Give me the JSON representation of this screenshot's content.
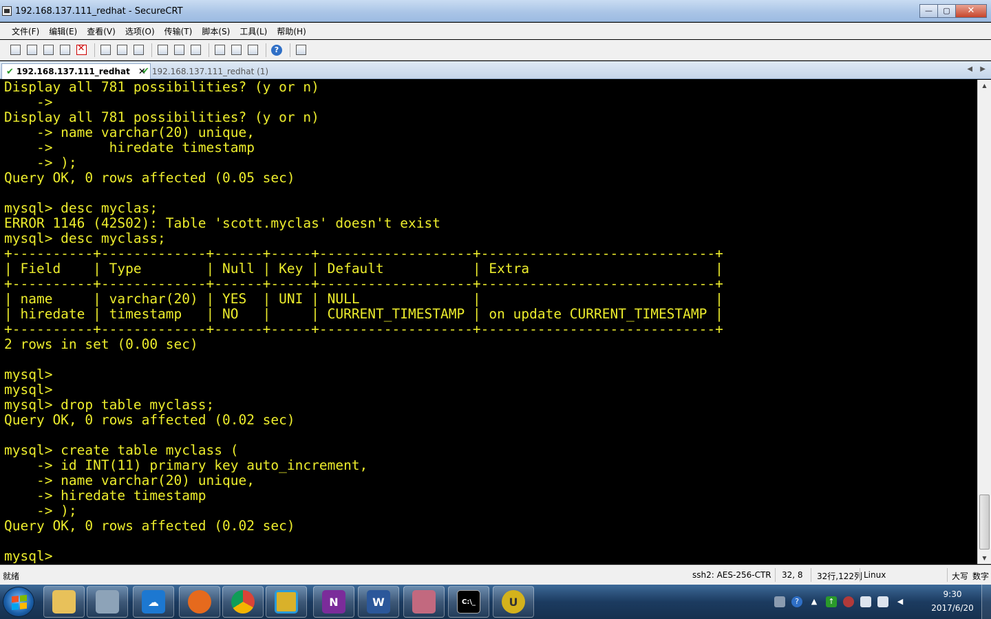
{
  "window": {
    "title": "192.168.137.111_redhat - SecureCRT",
    "minimize": "—",
    "maximize": "▢",
    "close": "✕"
  },
  "menu": [
    "文件(F)",
    "编辑(E)",
    "查看(V)",
    "选项(O)",
    "传输(T)",
    "脚本(S)",
    "工具(L)",
    "帮助(H)"
  ],
  "toolbar_icons": [
    "connect-icon",
    "quick-connect-icon",
    "connect-tab-icon",
    "reconnect-icon",
    "disconnect-icon",
    "copy-icon",
    "paste-icon",
    "find-icon",
    "print-icon",
    "print-selection-icon",
    "print-setup-icon",
    "session-options-icon",
    "global-options-icon",
    "keymap-icon",
    "help-icon",
    "sftp-icon"
  ],
  "tabs": [
    {
      "label": "192.168.137.111_redhat",
      "active": true,
      "close": "✕",
      "status": "✔"
    },
    {
      "label": "192.168.137.111_redhat (1)",
      "active": false,
      "status": "✔"
    }
  ],
  "tab_nav": {
    "left": "◀",
    "right": "▶"
  },
  "terminal": {
    "text_color": "#ECEC2C",
    "lines": [
      "Display all 781 possibilities? (y or n)",
      "    ->",
      "Display all 781 possibilities? (y or n)",
      "    -> name varchar(20) unique,",
      "    ->       hiredate timestamp",
      "    -> );",
      "Query OK, 0 rows affected (0.05 sec)",
      "",
      "mysql> desc myclas;",
      "ERROR 1146 (42S02): Table 'scott.myclas' doesn't exist",
      "mysql> desc myclass;",
      "+----------+-------------+------+-----+-------------------+-----------------------------+",
      "| Field    | Type        | Null | Key | Default           | Extra                       |",
      "+----------+-------------+------+-----+-------------------+-----------------------------+",
      "| name     | varchar(20) | YES  | UNI | NULL              |                             |",
      "| hiredate | timestamp   | NO   |     | CURRENT_TIMESTAMP | on update CURRENT_TIMESTAMP |",
      "+----------+-------------+------+-----+-------------------+-----------------------------+",
      "2 rows in set (0.00 sec)",
      "",
      "mysql>",
      "mysql>",
      "mysql> drop table myclass;",
      "Query OK, 0 rows affected (0.02 sec)",
      "",
      "mysql> create table myclass (",
      "    -> id INT(11) primary key auto_increment,",
      "    -> name varchar(20) unique,",
      "    -> hiredate timestamp",
      "    -> );",
      "Query OK, 0 rows affected (0.02 sec)",
      "",
      "mysql>"
    ]
  },
  "statusbar": {
    "ready": "就绪",
    "protocol": "ssh2: AES-256-CTR",
    "cursor": "32,  8",
    "size": "32行,122列",
    "emulation": "Linux",
    "caps": "大写",
    "num": "数字"
  },
  "taskbar": {
    "apps": [
      "windows-explorer-icon",
      "securecrt-icon",
      "cloud-sync-icon",
      "firefox-icon",
      "chrome-icon",
      "file-manager-icon",
      "onenote-icon",
      "word-icon",
      "database-tool-icon",
      "command-prompt-icon",
      "ultraedit-icon"
    ],
    "clock_time": "9:30",
    "clock_date": "2017/6/20"
  }
}
